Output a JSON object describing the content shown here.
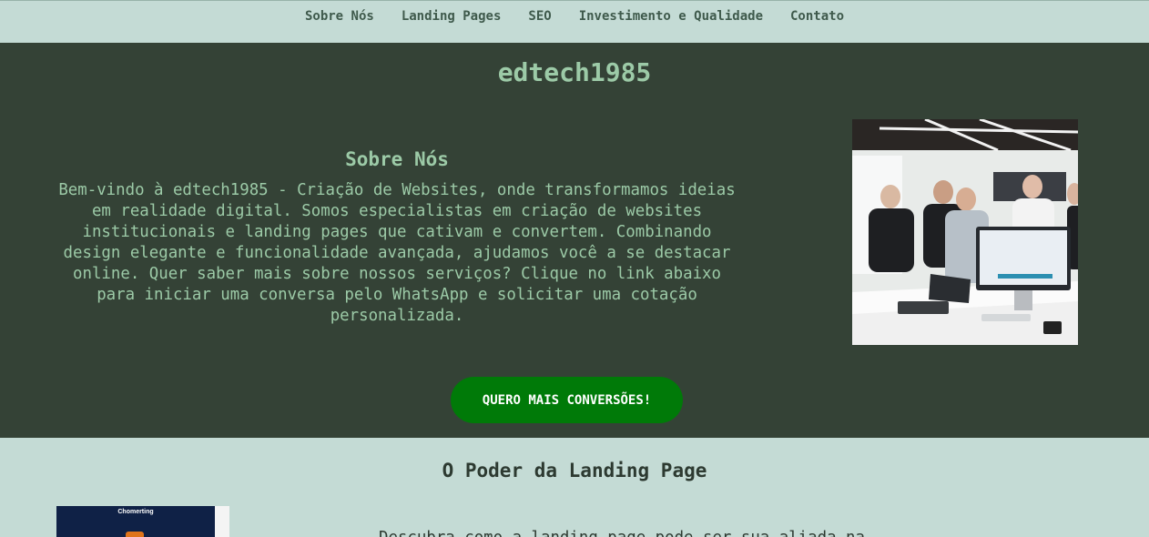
{
  "nav": {
    "items": [
      {
        "label": "Sobre Nós"
      },
      {
        "label": "Landing Pages"
      },
      {
        "label": "SEO"
      },
      {
        "label": "Investimento e Qualidade"
      },
      {
        "label": "Contato"
      }
    ]
  },
  "hero": {
    "site_title": "edtech1985",
    "about_heading": "Sobre Nós",
    "about_text": "Bem-vindo à edtech1985 - Criação de Websites, onde transformamos ideias em realidade digital. Somos especialistas em criação de websites institucionais e landing pages que cativam e convertem. Combinando design elegante e funcionalidade avançada, ajudamos você a se destacar online. Quer saber mais sobre nossos serviços? Clique no link abaixo para iniciar uma conversa pelo WhatsApp e solicitar uma cotação personalizada.",
    "cta_label": "QUERO MAIS CONVERSÕES!"
  },
  "landing_section": {
    "heading": "O Poder da Landing Page",
    "thumbnail_brand": "Chomerting",
    "text_partial": "Descubra como a landing page pode ser sua aliada na..."
  },
  "colors": {
    "nav_bg": "#c4dbd5",
    "hero_bg": "#344236",
    "hero_text": "#9ccaa7",
    "cta_bg": "#007a08"
  }
}
